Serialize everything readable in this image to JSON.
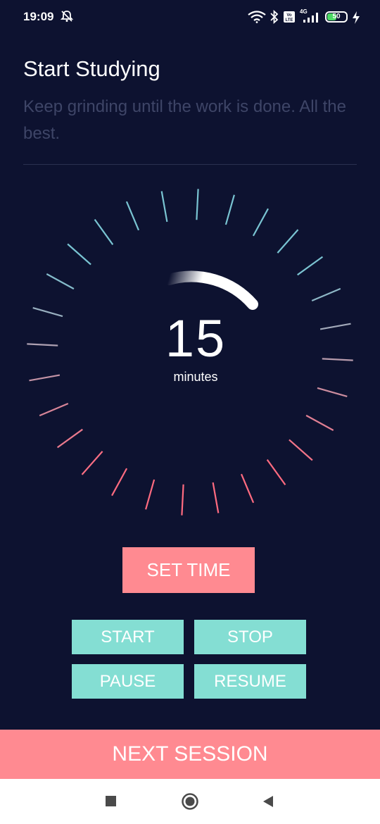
{
  "status_bar": {
    "time": "19:09",
    "battery_level": "50",
    "network_label": "4G",
    "icons": [
      "alarm-off-icon",
      "wifi-icon",
      "bluetooth-icon",
      "volte-icon",
      "signal-icon",
      "battery-icon",
      "charging-icon"
    ]
  },
  "header": {
    "title": "Start Studying",
    "subtitle": "Keep grinding until the work is done. All the best."
  },
  "timer": {
    "value": "15",
    "unit": "minutes",
    "tick_colors": {
      "top": "#79c4d2",
      "bottom": "#ff6b80"
    },
    "progress_color": "#ffffff"
  },
  "actions": {
    "set_time": "SET TIME",
    "start": "START",
    "stop": "STOP",
    "pause": "PAUSE",
    "resume": "RESUME",
    "next_session": "NEXT SESSION"
  },
  "colors": {
    "background": "#0d1230",
    "accent_pink": "#ff8a91",
    "accent_teal": "#84ded3"
  },
  "nav": {
    "icons": [
      "recents-icon",
      "home-icon",
      "back-icon"
    ]
  }
}
